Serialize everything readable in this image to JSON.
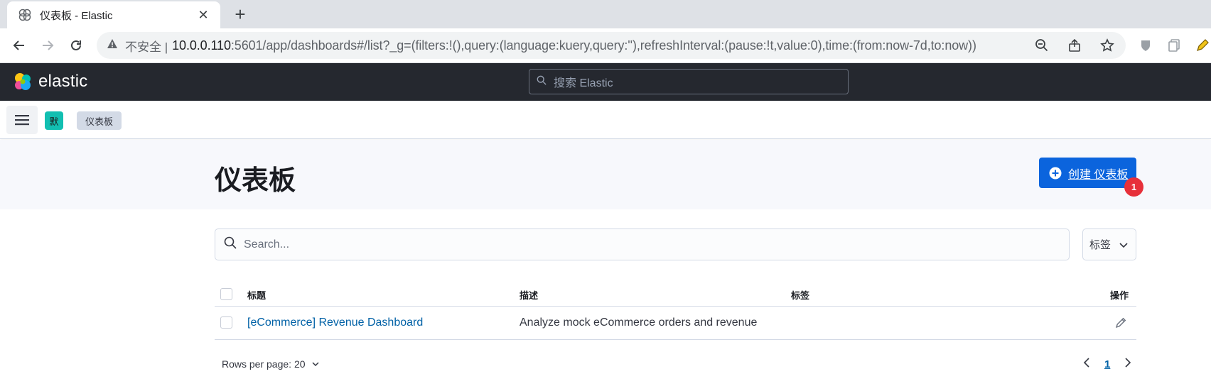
{
  "browser": {
    "tab_title": "仪表板 - Elastic",
    "tab_close": "✕",
    "new_tab": "+",
    "security_label": "不安全",
    "url_host": "10.0.0.110",
    "url_rest": ":5601/app/dashboards#/list?_g=(filters:!(),query:(language:kuery,query:''),refreshInterval:(pause:!t,value:0),time:(from:now-7d,to:now))"
  },
  "header": {
    "logo_text": "elastic",
    "search_placeholder": "搜索 Elastic"
  },
  "breadcrumbs": {
    "space_initial": "默",
    "items": [
      "仪表板"
    ]
  },
  "page": {
    "title": "仪表板",
    "create_button": "创建 仪表板",
    "badge_count": "1"
  },
  "search": {
    "placeholder": "Search...",
    "tags_filter_label": "标签"
  },
  "table": {
    "columns": [
      "标题",
      "描述",
      "标签",
      "操作"
    ],
    "rows": [
      {
        "title": "[eCommerce] Revenue Dashboard",
        "description": "Analyze mock eCommerce orders and revenue",
        "tags": ""
      }
    ]
  },
  "pagination": {
    "rows_per_page": "Rows per page: 20",
    "current_page": "1"
  },
  "colors": {
    "header_bg": "#25282f",
    "primary": "#0b64dd",
    "link": "#0061a6",
    "badge": "#e7303a",
    "space_avatar": "#12bfb1"
  }
}
